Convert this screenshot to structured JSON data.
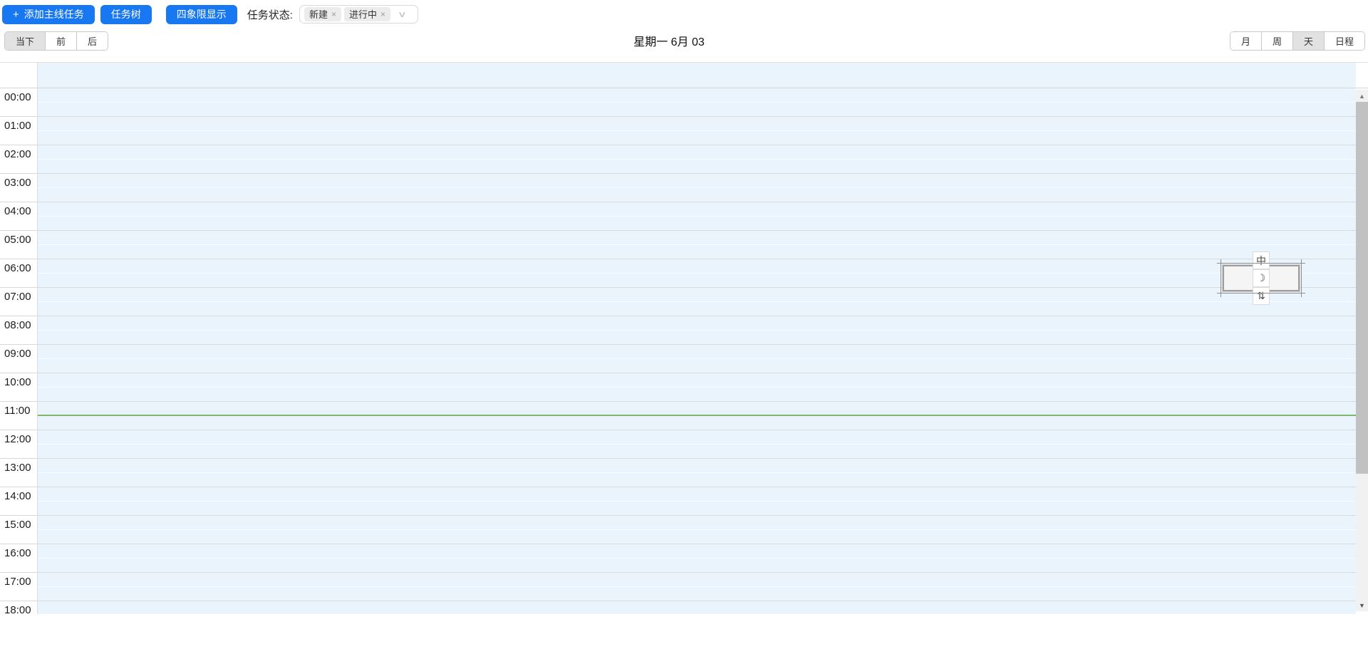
{
  "toolbar": {
    "plus_icon": "+",
    "add_main_task_label": "添加主线任务",
    "task_tree_label": "任务树",
    "quadrant_label": "四象限显示",
    "status_label": "任务状态:",
    "status_tags": [
      {
        "label": "新建",
        "close": "×"
      },
      {
        "label": "进行中",
        "close": "×"
      }
    ],
    "dropdown_icon": "∨"
  },
  "header": {
    "nav_buttons": [
      {
        "label": "当下",
        "active": true
      },
      {
        "label": "前",
        "active": false
      },
      {
        "label": "后",
        "active": false
      }
    ],
    "title": "星期一 6月 03",
    "view_buttons": [
      {
        "label": "月",
        "active": false
      },
      {
        "label": "周",
        "active": false
      },
      {
        "label": "天",
        "active": true
      },
      {
        "label": "日程",
        "active": false
      }
    ]
  },
  "calendar": {
    "hours": [
      "00:00",
      "01:00",
      "02:00",
      "03:00",
      "04:00",
      "05:00",
      "06:00",
      "07:00",
      "08:00",
      "09:00",
      "10:00",
      "11:00",
      "12:00",
      "13:00",
      "14:00",
      "15:00",
      "16:00",
      "17:00",
      "18:00"
    ],
    "current_time_line_color": "#7db96d"
  },
  "scrollbar": {
    "up_icon": "▲",
    "down_icon": "▼"
  },
  "ime_toolbar": {
    "items": [
      {
        "name": "chinese-mode-icon",
        "glyph": "中"
      },
      {
        "name": "halfwidth-moon-icon",
        "glyph": "☽"
      },
      {
        "name": "ime-tools-icon",
        "glyph": "⇅"
      }
    ]
  },
  "colors": {
    "accent_blue": "#1778f2",
    "grid_cell_blue": "#e9f4fd",
    "hour_line_gray": "#d9d9d9",
    "current_time_green": "#7db96d"
  }
}
